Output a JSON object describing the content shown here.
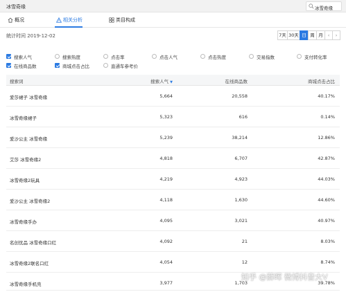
{
  "header": {
    "title": "冰雪奇缘",
    "search_value": "冰雪奇缘"
  },
  "tabs": [
    {
      "label": "概况"
    },
    {
      "label": "相关分析"
    },
    {
      "label": "类目构成"
    }
  ],
  "stat_time": "统计时间 2019-12-02",
  "periods": {
    "d7": "7天",
    "d30": "30天",
    "day": "日",
    "week": "周",
    "month": "月",
    "prev": "‹",
    "next": "›"
  },
  "metrics": [
    {
      "label": "搜索人气",
      "checked": true
    },
    {
      "label": "搜索热度",
      "checked": false
    },
    {
      "label": "点击率",
      "checked": false
    },
    {
      "label": "点击人气",
      "checked": false
    },
    {
      "label": "点击热度",
      "checked": false
    },
    {
      "label": "交易指数",
      "checked": false
    },
    {
      "label": "支付转化率",
      "checked": false
    },
    {
      "label": "在线商品数",
      "checked": true
    },
    {
      "label": "商城点击占比",
      "checked": true
    },
    {
      "label": "直通车参考价",
      "checked": false
    }
  ],
  "table": {
    "headers": {
      "keyword": "搜索词",
      "search_pop": "搜索人气",
      "online_items": "在线商品数",
      "mall_click_ratio": "商城点击占比"
    },
    "rows": [
      {
        "keyword": "爱莎裙子 冰雪奇缘",
        "search_pop": "5,664",
        "online_items": "20,558",
        "mall_click_ratio": "40.17%"
      },
      {
        "keyword": "冰雪奇缘裙子",
        "search_pop": "5,323",
        "online_items": "616",
        "mall_click_ratio": "0.14%"
      },
      {
        "keyword": "爱沙公主 冰雪奇缘",
        "search_pop": "5,239",
        "online_items": "38,214",
        "mall_click_ratio": "12.86%"
      },
      {
        "keyword": "艾莎 冰雪奇缘2",
        "search_pop": "4,818",
        "online_items": "6,707",
        "mall_click_ratio": "42.87%"
      },
      {
        "keyword": "冰雪奇缘2玩具",
        "search_pop": "4,219",
        "online_items": "4,923",
        "mall_click_ratio": "44.03%"
      },
      {
        "keyword": "爱沙公主 冰雪奇缘2",
        "search_pop": "4,118",
        "online_items": "1,630",
        "mall_click_ratio": "44.60%"
      },
      {
        "keyword": "冰雪奇缘手办",
        "search_pop": "4,095",
        "online_items": "3,021",
        "mall_click_ratio": "40.97%"
      },
      {
        "keyword": "名创优品 冰雪奇缘口红",
        "search_pop": "4,092",
        "online_items": "21",
        "mall_click_ratio": "8.03%"
      },
      {
        "keyword": "冰雪奇缘2联名口红",
        "search_pop": "4,054",
        "online_items": "12",
        "mall_click_ratio": "8.74%"
      },
      {
        "keyword": "冰雪奇缘手机壳",
        "search_pop": "3,977",
        "online_items": "1,703",
        "mall_click_ratio": "39.78%"
      }
    ]
  },
  "watermark": "知乎 @薛晖 微博抖音大V",
  "colors": {
    "accent": "#2a7ae2"
  }
}
